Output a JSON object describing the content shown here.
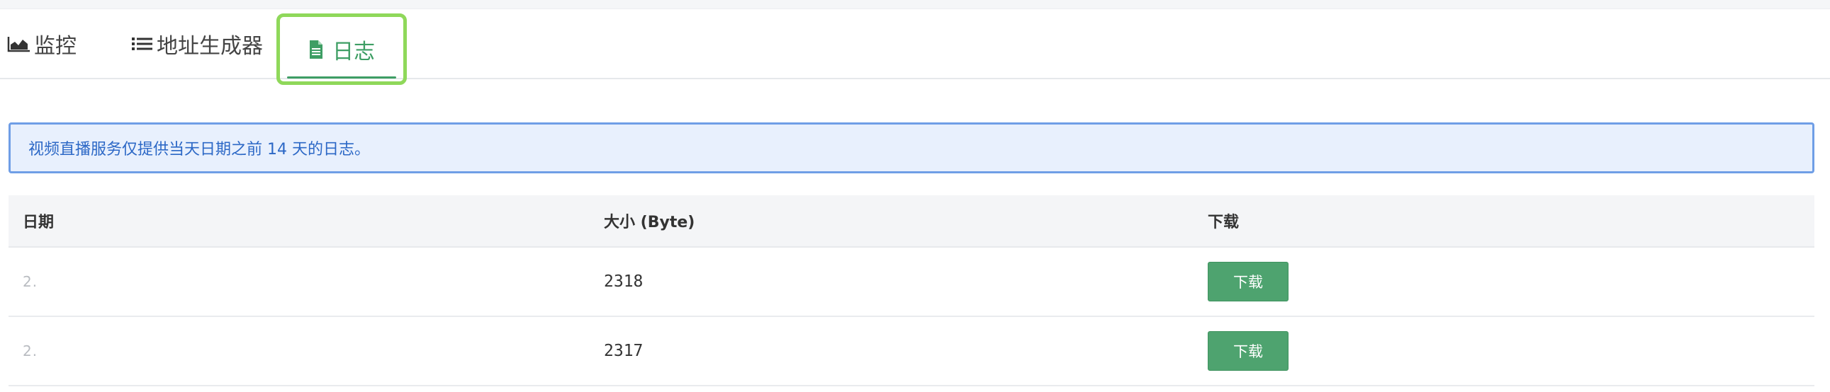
{
  "tabs": [
    {
      "label": "监控",
      "icon": "area-chart-icon"
    },
    {
      "label": "地址生成器",
      "icon": "list-icon"
    },
    {
      "label": "日志",
      "icon": "file-icon"
    }
  ],
  "notice": {
    "text": "视频直播服务仅提供当天日期之前 14 天的日志。"
  },
  "table": {
    "headers": [
      "日期",
      "大小 (Byte)",
      "下载"
    ],
    "rows": [
      {
        "date": "2.",
        "size": "2318",
        "action": "下载"
      },
      {
        "date": "2.",
        "size": "2317",
        "action": "下载"
      }
    ]
  },
  "colors": {
    "accent": "#3e9e64",
    "highlight": "#8fd85a",
    "notice_bg": "#e8f0fd",
    "notice_border": "#6f9ee6",
    "button": "#4ea36f"
  }
}
